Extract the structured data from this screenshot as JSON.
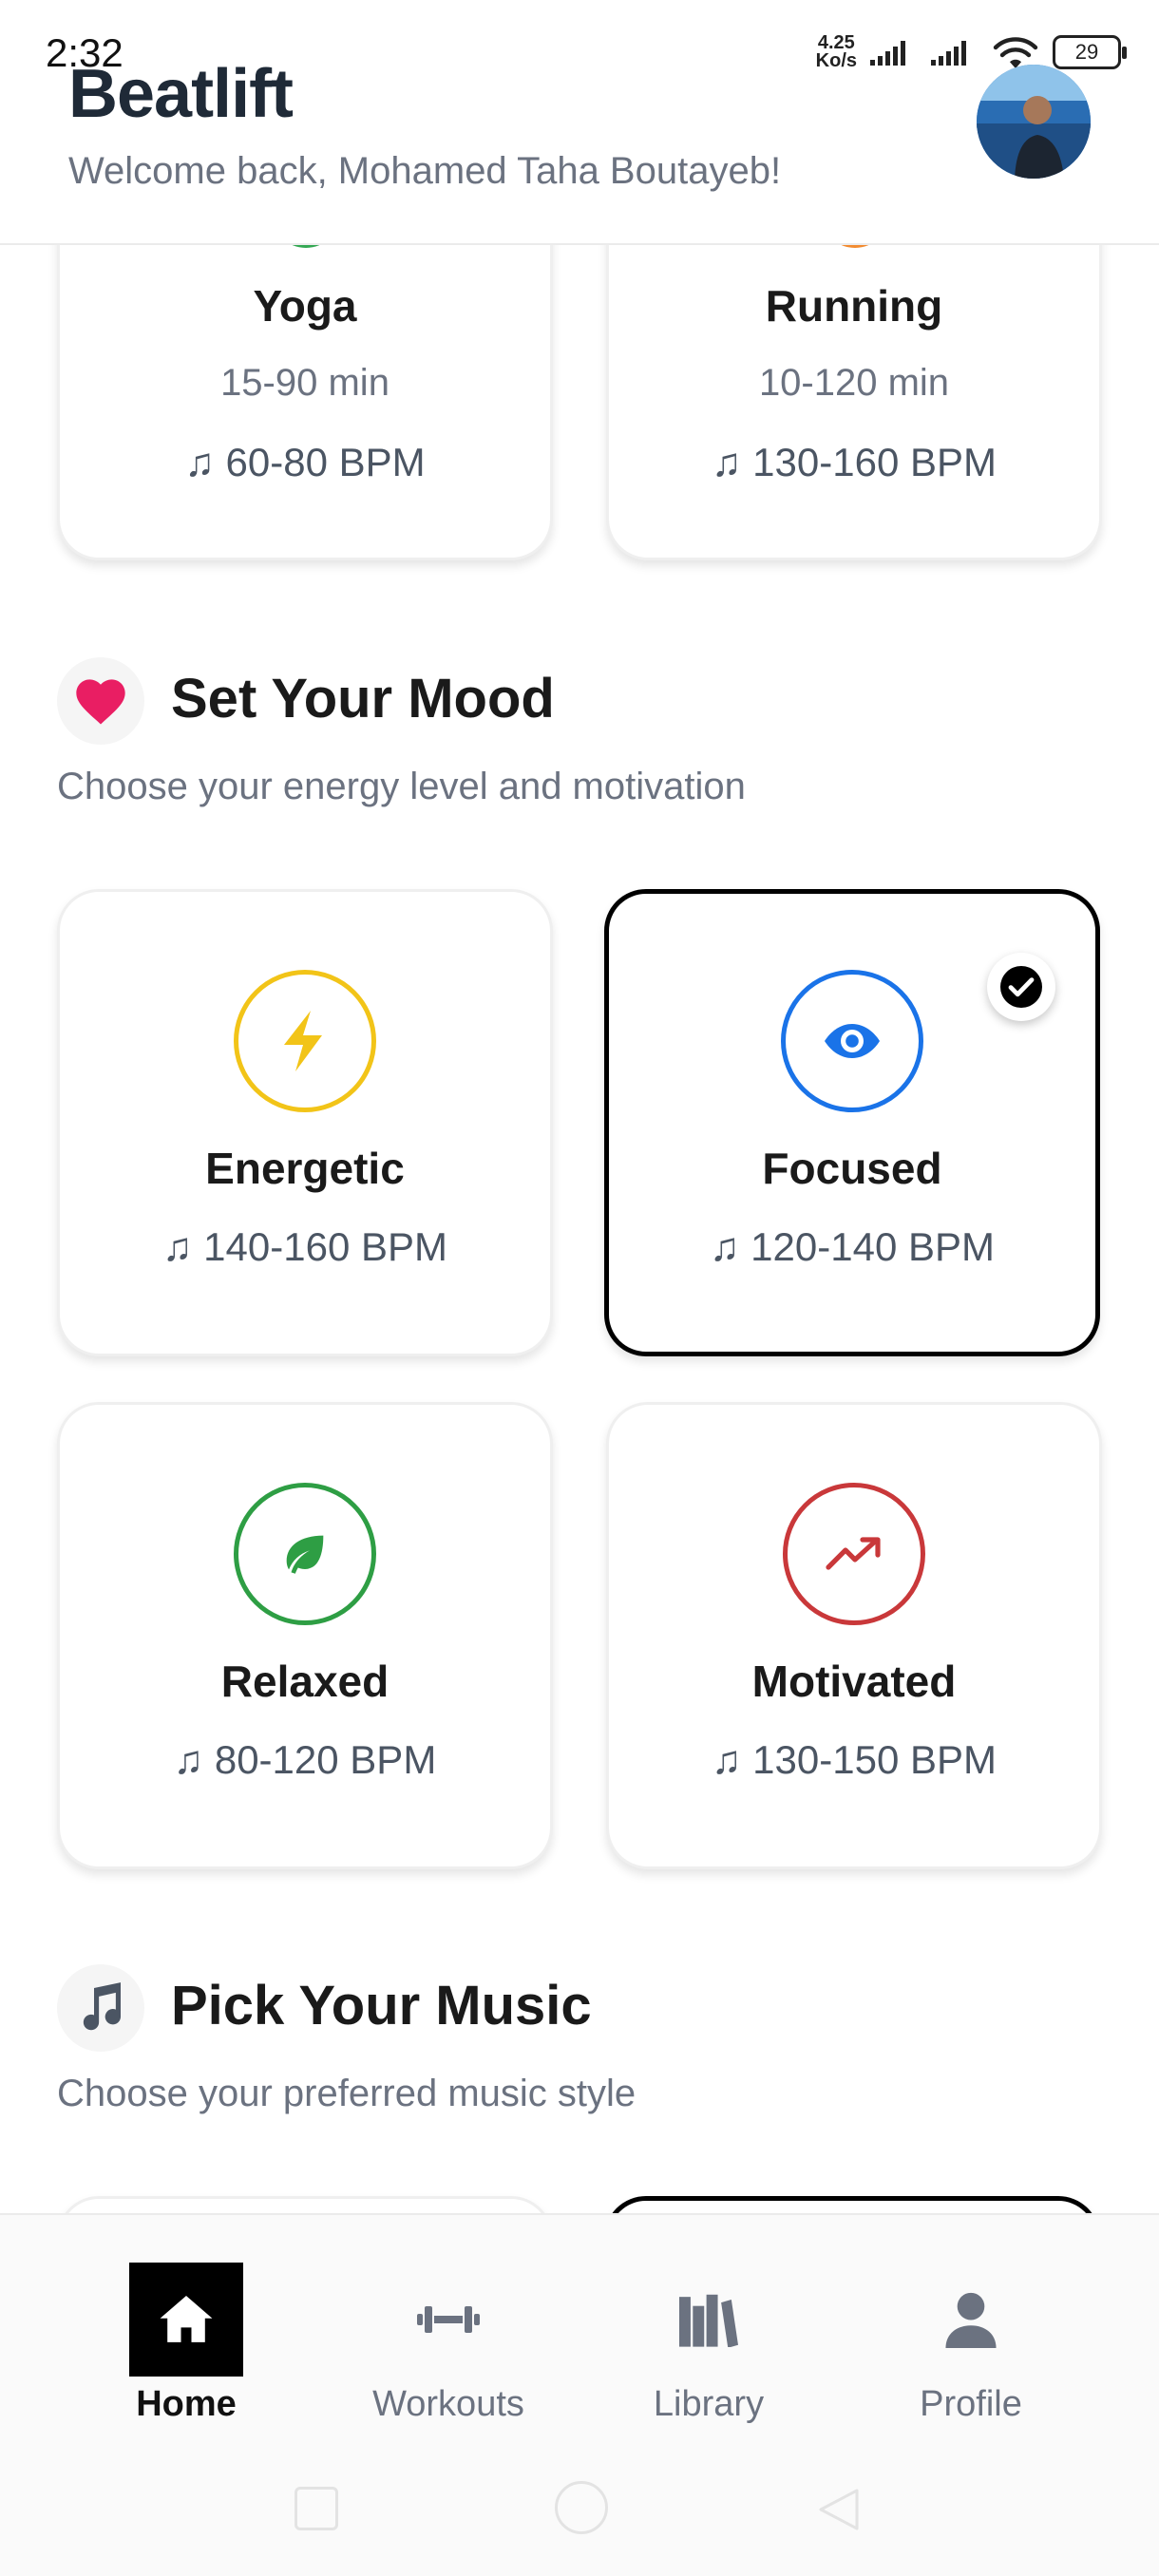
{
  "status_bar": {
    "time": "2:32",
    "net_speed_value": "4.25",
    "net_speed_unit": "Ko/s",
    "battery": "29"
  },
  "header": {
    "title": "Beatlift",
    "welcome": "Welcome back, Mohamed Taha Boutayeb!"
  },
  "workouts": [
    {
      "name": "Yoga",
      "duration": "15-90 min",
      "bpm": "♫ 60-80 BPM",
      "accent": "#34a853"
    },
    {
      "name": "Running",
      "duration": "10-120 min",
      "bpm": "♫ 130-160 BPM",
      "accent": "#f28b30"
    }
  ],
  "mood_section": {
    "title": "Set Your Mood",
    "subtitle": "Choose your energy level and motivation",
    "icon": "heart-icon"
  },
  "moods": [
    {
      "name": "Energetic",
      "bpm": "♫ 140-160 BPM",
      "icon": "lightning-icon",
      "color": "#f2c418",
      "selected": false
    },
    {
      "name": "Focused",
      "bpm": "♫ 120-140 BPM",
      "icon": "eye-icon",
      "color": "#1a73e8",
      "selected": true
    },
    {
      "name": "Relaxed",
      "bpm": "♫ 80-120 BPM",
      "icon": "leaf-icon",
      "color": "#2e9e44",
      "selected": false
    },
    {
      "name": "Motivated",
      "bpm": "♫ 130-150 BPM",
      "icon": "trending-up-icon",
      "color": "#c9383a",
      "selected": false
    }
  ],
  "music_section": {
    "title": "Pick Your Music",
    "subtitle": "Choose your preferred music style",
    "icon": "music-note-icon"
  },
  "nav": {
    "items": [
      {
        "label": "Home",
        "icon": "home-icon",
        "active": true
      },
      {
        "label": "Workouts",
        "icon": "dumbbell-icon",
        "active": false
      },
      {
        "label": "Library",
        "icon": "library-icon",
        "active": false
      },
      {
        "label": "Profile",
        "icon": "person-icon",
        "active": false
      }
    ]
  },
  "colors": {
    "title": "#1f2a37",
    "muted_text": "#6b7280",
    "heart": "#e91e63",
    "selected_border": "#000000"
  }
}
